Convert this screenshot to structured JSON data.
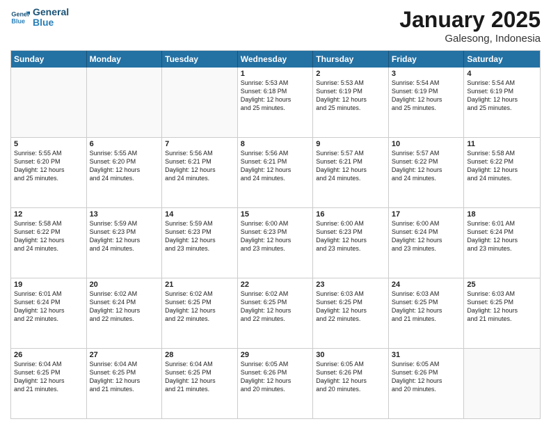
{
  "header": {
    "logo_line1": "General",
    "logo_line2": "Blue",
    "month": "January 2025",
    "location": "Galesong, Indonesia"
  },
  "day_headers": [
    "Sunday",
    "Monday",
    "Tuesday",
    "Wednesday",
    "Thursday",
    "Friday",
    "Saturday"
  ],
  "weeks": [
    [
      {
        "num": "",
        "info": "",
        "empty": true
      },
      {
        "num": "",
        "info": "",
        "empty": true
      },
      {
        "num": "",
        "info": "",
        "empty": true
      },
      {
        "num": "1",
        "info": "Sunrise: 5:53 AM\nSunset: 6:18 PM\nDaylight: 12 hours\nand 25 minutes.",
        "empty": false
      },
      {
        "num": "2",
        "info": "Sunrise: 5:53 AM\nSunset: 6:19 PM\nDaylight: 12 hours\nand 25 minutes.",
        "empty": false
      },
      {
        "num": "3",
        "info": "Sunrise: 5:54 AM\nSunset: 6:19 PM\nDaylight: 12 hours\nand 25 minutes.",
        "empty": false
      },
      {
        "num": "4",
        "info": "Sunrise: 5:54 AM\nSunset: 6:19 PM\nDaylight: 12 hours\nand 25 minutes.",
        "empty": false
      }
    ],
    [
      {
        "num": "5",
        "info": "Sunrise: 5:55 AM\nSunset: 6:20 PM\nDaylight: 12 hours\nand 25 minutes.",
        "empty": false
      },
      {
        "num": "6",
        "info": "Sunrise: 5:55 AM\nSunset: 6:20 PM\nDaylight: 12 hours\nand 24 minutes.",
        "empty": false
      },
      {
        "num": "7",
        "info": "Sunrise: 5:56 AM\nSunset: 6:21 PM\nDaylight: 12 hours\nand 24 minutes.",
        "empty": false
      },
      {
        "num": "8",
        "info": "Sunrise: 5:56 AM\nSunset: 6:21 PM\nDaylight: 12 hours\nand 24 minutes.",
        "empty": false
      },
      {
        "num": "9",
        "info": "Sunrise: 5:57 AM\nSunset: 6:21 PM\nDaylight: 12 hours\nand 24 minutes.",
        "empty": false
      },
      {
        "num": "10",
        "info": "Sunrise: 5:57 AM\nSunset: 6:22 PM\nDaylight: 12 hours\nand 24 minutes.",
        "empty": false
      },
      {
        "num": "11",
        "info": "Sunrise: 5:58 AM\nSunset: 6:22 PM\nDaylight: 12 hours\nand 24 minutes.",
        "empty": false
      }
    ],
    [
      {
        "num": "12",
        "info": "Sunrise: 5:58 AM\nSunset: 6:22 PM\nDaylight: 12 hours\nand 24 minutes.",
        "empty": false
      },
      {
        "num": "13",
        "info": "Sunrise: 5:59 AM\nSunset: 6:23 PM\nDaylight: 12 hours\nand 24 minutes.",
        "empty": false
      },
      {
        "num": "14",
        "info": "Sunrise: 5:59 AM\nSunset: 6:23 PM\nDaylight: 12 hours\nand 23 minutes.",
        "empty": false
      },
      {
        "num": "15",
        "info": "Sunrise: 6:00 AM\nSunset: 6:23 PM\nDaylight: 12 hours\nand 23 minutes.",
        "empty": false
      },
      {
        "num": "16",
        "info": "Sunrise: 6:00 AM\nSunset: 6:23 PM\nDaylight: 12 hours\nand 23 minutes.",
        "empty": false
      },
      {
        "num": "17",
        "info": "Sunrise: 6:00 AM\nSunset: 6:24 PM\nDaylight: 12 hours\nand 23 minutes.",
        "empty": false
      },
      {
        "num": "18",
        "info": "Sunrise: 6:01 AM\nSunset: 6:24 PM\nDaylight: 12 hours\nand 23 minutes.",
        "empty": false
      }
    ],
    [
      {
        "num": "19",
        "info": "Sunrise: 6:01 AM\nSunset: 6:24 PM\nDaylight: 12 hours\nand 22 minutes.",
        "empty": false
      },
      {
        "num": "20",
        "info": "Sunrise: 6:02 AM\nSunset: 6:24 PM\nDaylight: 12 hours\nand 22 minutes.",
        "empty": false
      },
      {
        "num": "21",
        "info": "Sunrise: 6:02 AM\nSunset: 6:25 PM\nDaylight: 12 hours\nand 22 minutes.",
        "empty": false
      },
      {
        "num": "22",
        "info": "Sunrise: 6:02 AM\nSunset: 6:25 PM\nDaylight: 12 hours\nand 22 minutes.",
        "empty": false
      },
      {
        "num": "23",
        "info": "Sunrise: 6:03 AM\nSunset: 6:25 PM\nDaylight: 12 hours\nand 22 minutes.",
        "empty": false
      },
      {
        "num": "24",
        "info": "Sunrise: 6:03 AM\nSunset: 6:25 PM\nDaylight: 12 hours\nand 21 minutes.",
        "empty": false
      },
      {
        "num": "25",
        "info": "Sunrise: 6:03 AM\nSunset: 6:25 PM\nDaylight: 12 hours\nand 21 minutes.",
        "empty": false
      }
    ],
    [
      {
        "num": "26",
        "info": "Sunrise: 6:04 AM\nSunset: 6:25 PM\nDaylight: 12 hours\nand 21 minutes.",
        "empty": false
      },
      {
        "num": "27",
        "info": "Sunrise: 6:04 AM\nSunset: 6:25 PM\nDaylight: 12 hours\nand 21 minutes.",
        "empty": false
      },
      {
        "num": "28",
        "info": "Sunrise: 6:04 AM\nSunset: 6:25 PM\nDaylight: 12 hours\nand 21 minutes.",
        "empty": false
      },
      {
        "num": "29",
        "info": "Sunrise: 6:05 AM\nSunset: 6:26 PM\nDaylight: 12 hours\nand 20 minutes.",
        "empty": false
      },
      {
        "num": "30",
        "info": "Sunrise: 6:05 AM\nSunset: 6:26 PM\nDaylight: 12 hours\nand 20 minutes.",
        "empty": false
      },
      {
        "num": "31",
        "info": "Sunrise: 6:05 AM\nSunset: 6:26 PM\nDaylight: 12 hours\nand 20 minutes.",
        "empty": false
      },
      {
        "num": "",
        "info": "",
        "empty": true
      }
    ]
  ]
}
